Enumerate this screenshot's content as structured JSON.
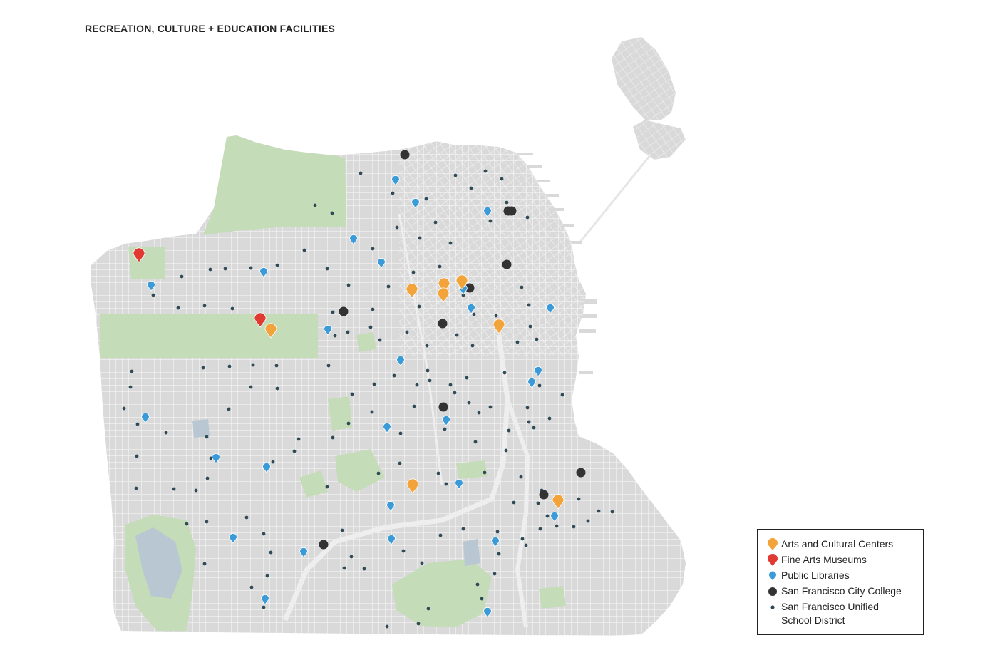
{
  "title": "RECREATION, CULTURE + EDUCATION FACILITIES",
  "colors": {
    "land": "#d9d9d9",
    "streets": "#f2f2f2",
    "park": "#c5dcb8",
    "water": "#b8c7d2",
    "arts": "#f2a43a",
    "museums": "#e03a33",
    "libraries": "#3b9bd9",
    "college": "#333333",
    "schools": "#2f4a57"
  },
  "legend": [
    {
      "key": "arts",
      "label": "Arts and Cultural Centers",
      "icon": "orange-pin-icon"
    },
    {
      "key": "museums",
      "label": "Fine Arts Museums",
      "icon": "red-pin-icon"
    },
    {
      "key": "libraries",
      "label": "Public Libraries",
      "icon": "blue-pin-icon"
    },
    {
      "key": "college",
      "label": "San Francisco City College",
      "icon": "black-dot-icon"
    },
    {
      "key": "schools",
      "label": "San Francisco Unified\nSchool District",
      "icon": "small-dot-icon"
    }
  ]
}
